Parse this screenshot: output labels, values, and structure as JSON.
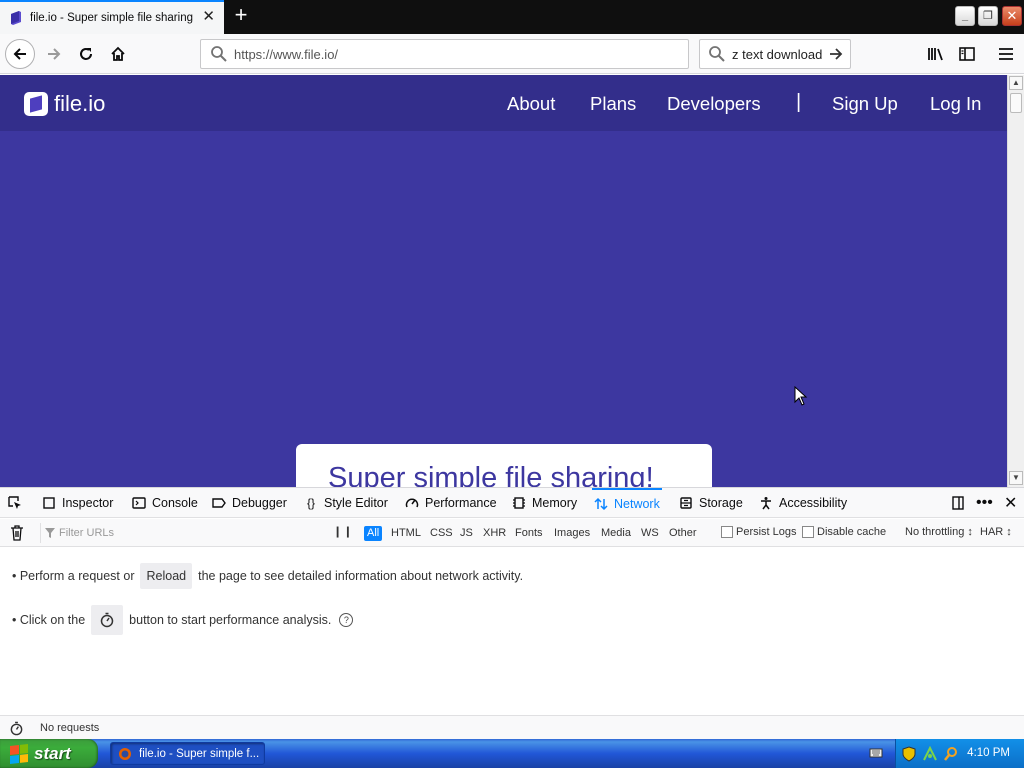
{
  "browser": {
    "tab_title": "file.io - Super simple file sharing",
    "url": "https://www.file.io/",
    "search_text": "z text download"
  },
  "site": {
    "logo_text": "file.io",
    "nav": {
      "about": "About",
      "plans": "Plans",
      "developers": "Developers",
      "divider": "|",
      "signup": "Sign Up",
      "login": "Log In"
    },
    "hero_title_pre": "Super simple file ",
    "hero_title_link": "sharing",
    "hero_title_post": "!",
    "colors": {
      "header": "#332e8b",
      "background": "#3d37a0",
      "accent": "#4a90e2"
    }
  },
  "devtools": {
    "tabs": {
      "inspector": "Inspector",
      "console": "Console",
      "debugger": "Debugger",
      "style_editor": "Style Editor",
      "performance": "Performance",
      "memory": "Memory",
      "network": "Network",
      "storage": "Storage",
      "accessibility": "Accessibility"
    },
    "active_tab": "Network",
    "filter_placeholder": "Filter URLs",
    "types": {
      "all": "All",
      "html": "HTML",
      "css": "CSS",
      "js": "JS",
      "xhr": "XHR",
      "fonts": "Fonts",
      "images": "Images",
      "media": "Media",
      "ws": "WS",
      "other": "Other"
    },
    "persist_logs": "Persist Logs",
    "disable_cache": "Disable cache",
    "throttling": "No throttling ↕",
    "har": "HAR ↕",
    "empty": {
      "line1_pre": "• Perform a request or",
      "reload": "Reload",
      "line1_post": "the page to see detailed information about network activity.",
      "line2_pre": "• Click on the",
      "line2_post": "button to start performance analysis."
    },
    "status": "No requests"
  },
  "taskbar": {
    "start": "start",
    "task": "file.io - Super simple f...",
    "clock": "4:10 PM"
  }
}
